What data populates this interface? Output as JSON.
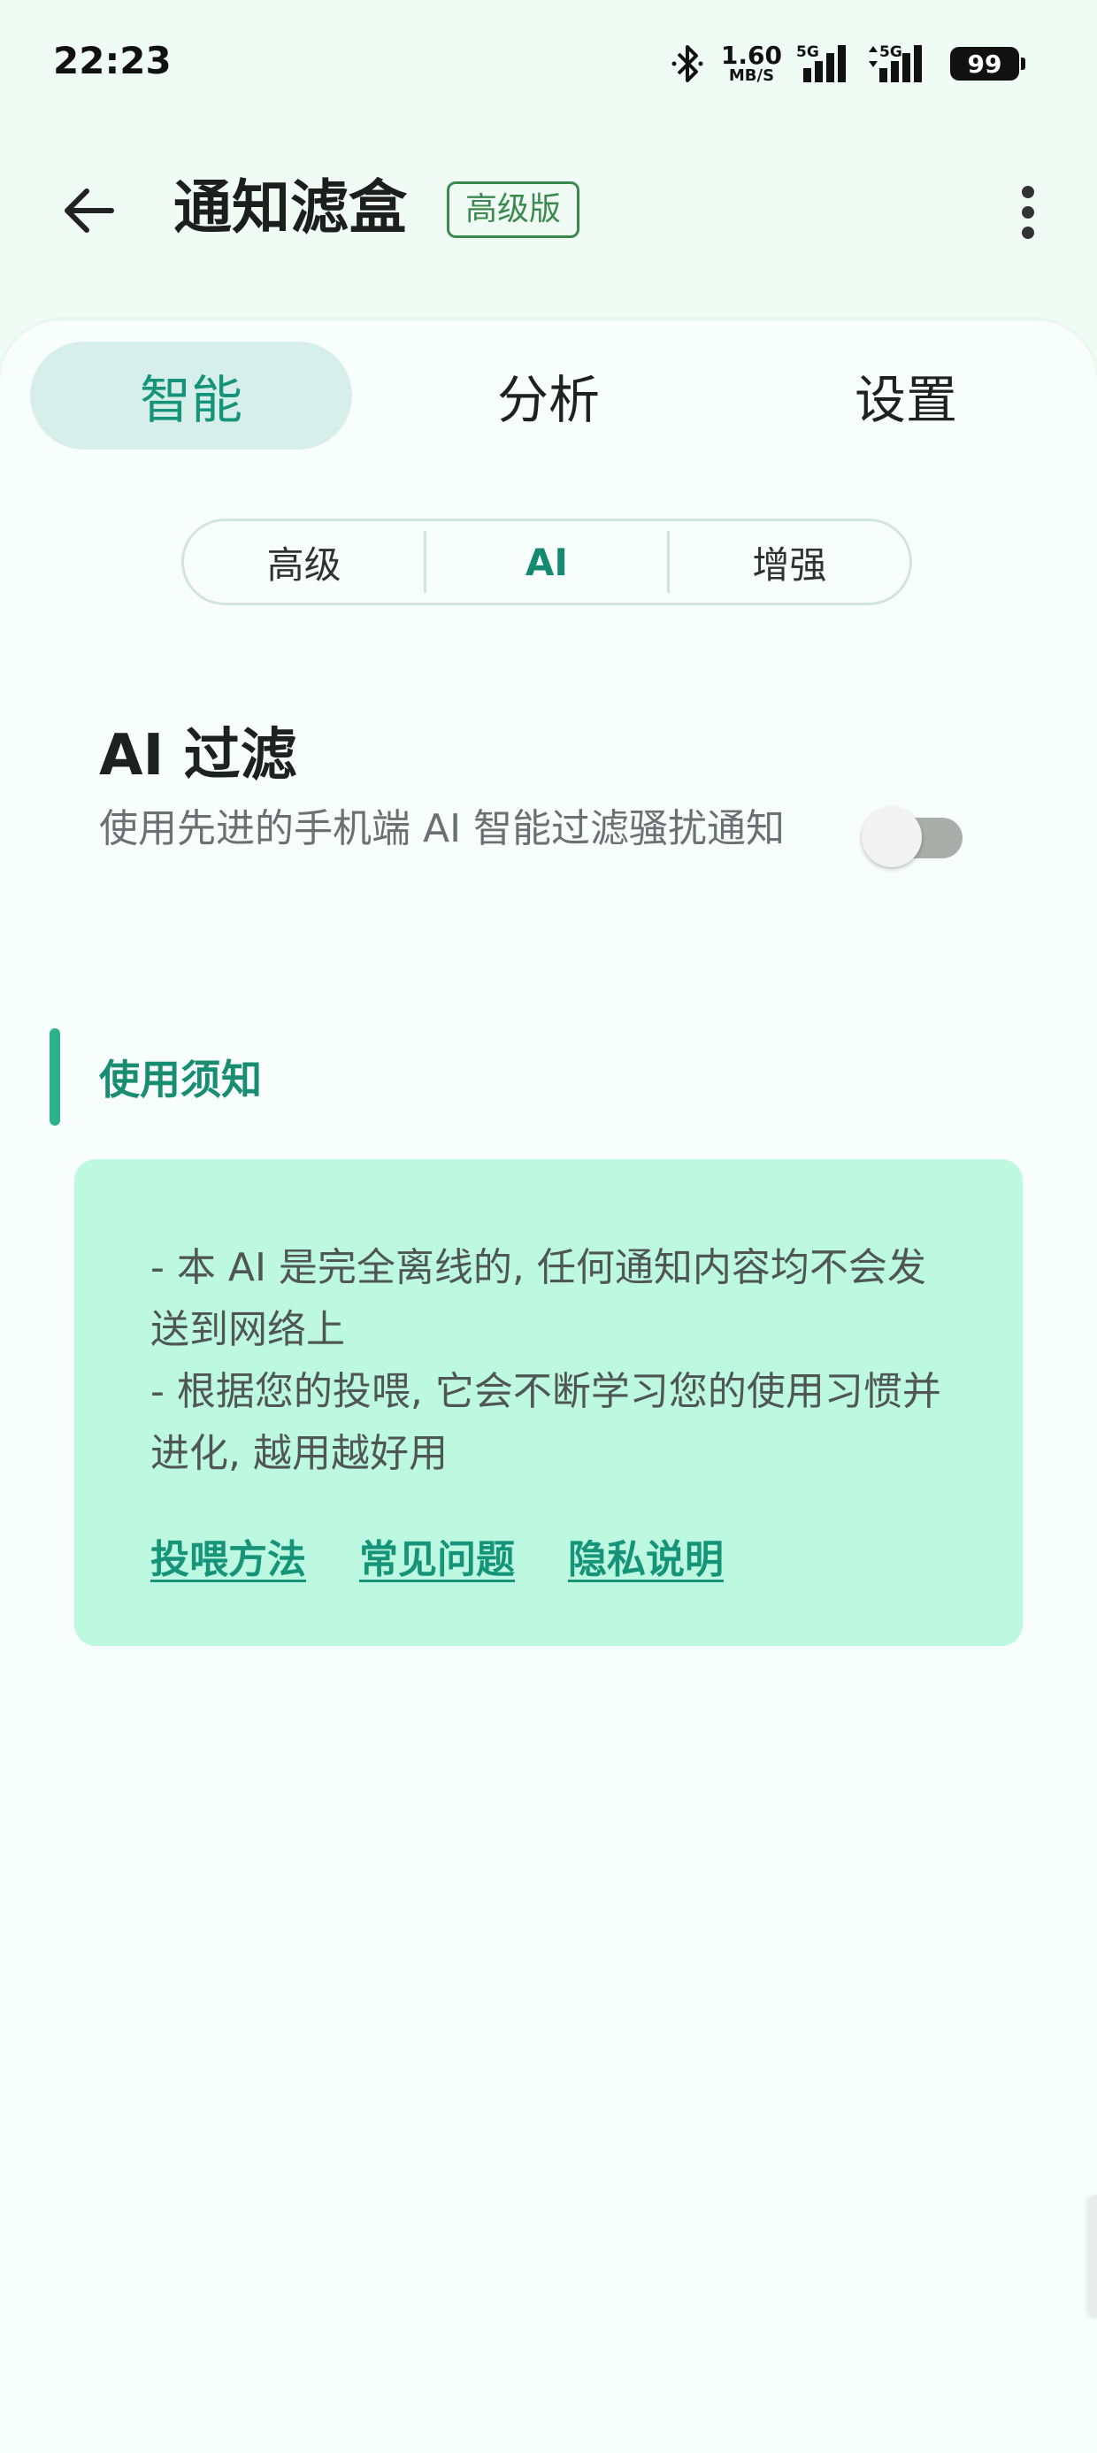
{
  "status_bar": {
    "time": "22:23",
    "net_speed_value": "1.60",
    "net_speed_unit": "MB/S",
    "signal1_label": "5G",
    "signal2_label": "5G",
    "battery": "99"
  },
  "app_bar": {
    "title": "通知滤盒",
    "badge": "高级版"
  },
  "primary_tabs": [
    {
      "label": "智能",
      "active": true
    },
    {
      "label": "分析",
      "active": false
    },
    {
      "label": "设置",
      "active": false
    }
  ],
  "segments": [
    {
      "label": "高级",
      "active": false
    },
    {
      "label": "AI",
      "active": true
    },
    {
      "label": "增强",
      "active": false
    }
  ],
  "ai_filter": {
    "title": "AI 过滤",
    "description": "使用先进的手机端 AI 智能过滤骚扰通知",
    "enabled": false
  },
  "notice": {
    "section_title": "使用须知",
    "lines": [
      "- 本 AI 是完全离线的, 任何通知内容均不会发送到网络上",
      "- 根据您的投喂, 它会不断学习您的使用习惯并进化, 越用越好用"
    ],
    "links": [
      "投喂方法",
      "常见问题",
      "隐私说明"
    ]
  },
  "colors": {
    "accent": "#169479",
    "tab_active_bg": "#d6efea",
    "notice_bg": "#bdf8e0",
    "section_bar": "#2fb28c",
    "badge": "#3a8a4e"
  }
}
